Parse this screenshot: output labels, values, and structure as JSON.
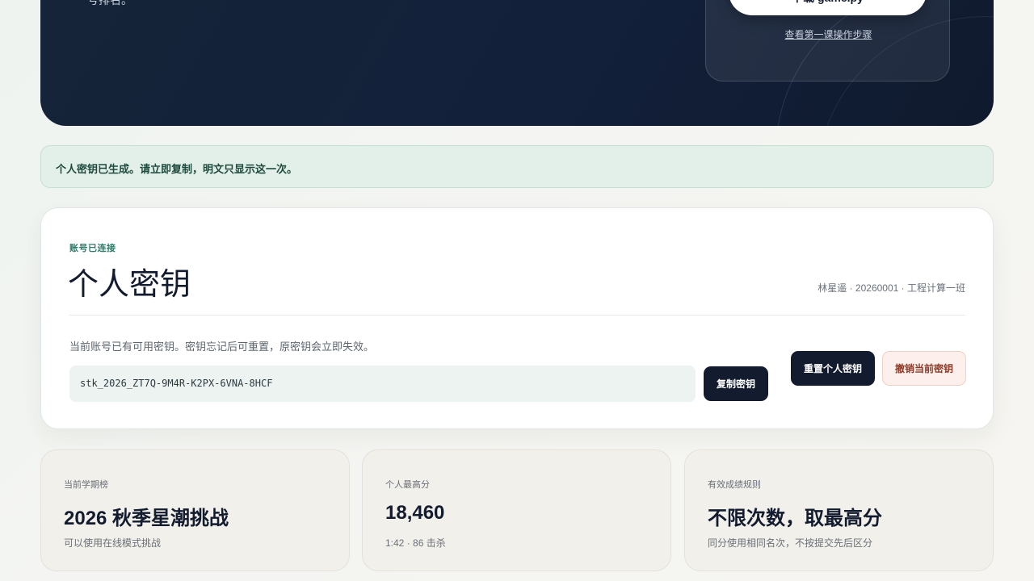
{
  "hero": {
    "partial_text": "号排名。",
    "download_label": "下载 game.py",
    "lesson_link": "查看第一课操作步骤"
  },
  "notice": {
    "text": "个人密钥已生成。请立即复制，明文只显示这一次。"
  },
  "key_card": {
    "eyebrow": "账号已连接",
    "title": "个人密钥",
    "user_meta": "林星遥 · 20260001 · 工程计算一班",
    "description": "当前账号已有可用密钥。密钥忘记后可重置，原密钥会立即失效。",
    "key_value": "stk_2026_ZT7Q-9M4R-K2PX-6VNA-8HCF",
    "copy_label": "复制密钥",
    "reset_label": "重置个人密钥",
    "revoke_label": "撤销当前密钥"
  },
  "stats": [
    {
      "label": "当前学期榜",
      "value": "2026 秋季星潮挑战",
      "sub": "可以使用在线模式挑战"
    },
    {
      "label": "个人最高分",
      "value": "18,460",
      "sub": "1:42 · 86 击杀"
    },
    {
      "label": "有效成绩规则",
      "value": "不限次数，取最高分",
      "sub": "同分使用相同名次，不按提交先后区分"
    }
  ],
  "colors": {
    "hero_bg": "#13203a",
    "accent": "#2f7a68",
    "notice_bg": "#e3f0ea",
    "dark_button": "#131b2e",
    "danger_bg": "#fdf0ec",
    "danger_text": "#8a3a28"
  }
}
